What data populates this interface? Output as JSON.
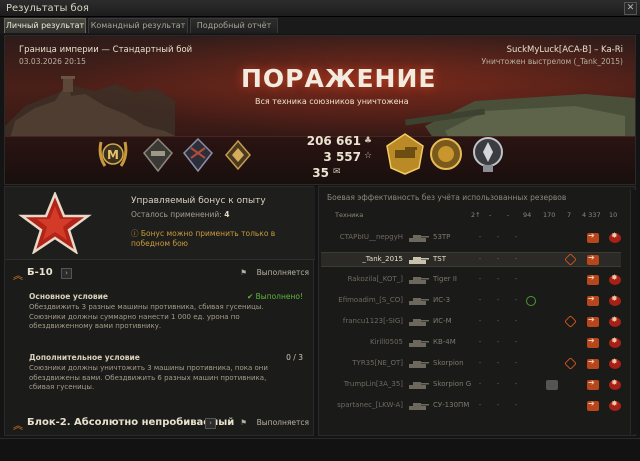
{
  "window": {
    "title": "Результаты боя"
  },
  "tabs": [
    {
      "label": "Личный результат",
      "active": true
    },
    {
      "label": "Командный результат",
      "active": false
    },
    {
      "label": "Подробный отчёт",
      "active": false
    }
  ],
  "header": {
    "map": "Граница империи — Стандартный бой",
    "date": "03.03.2026 20:15",
    "player": "SuckMyLuck[ACA-B] – Ka-Ri",
    "killed_by": "Уничтожен выстрелом (_Tank_2015)",
    "result": "ПОРАЖЕНИЕ",
    "result_sub": "Вся техника союзников уничтожена"
  },
  "stats": {
    "credits": "206 661",
    "xp": "3 557",
    "free_xp": "35"
  },
  "bonus": {
    "title": "Управляемый бонус к опыту",
    "remaining_label": "Осталось применений:",
    "remaining_value": "4",
    "warning": "Бонус можно применить только в победном бою"
  },
  "missions": [
    {
      "name": "Б-10",
      "status": "Выполняется",
      "main_title": "Основное условие",
      "main_done": "✔ Выполнено!",
      "main_text": "Обездвижить 3 разные машины противника, сбивая гусеницы. Союзники должны суммарно нанести 1 000 ед. урона по обездвиженному вами противнику.",
      "extra_title": "Дополнительное условие",
      "extra_count": "0 / 3",
      "extra_text": "Союзники должны уничтожить 3 машины противника, пока они обездвижены вами. Обездвижить 6 разных машин противника, сбивая гусеницы."
    },
    {
      "name": "Блок-2. Абсолютно непробиваемый",
      "status": "Выполняется"
    }
  ],
  "efficiency": {
    "title": "Боевая эффективность без учёта использованных резервов",
    "column_tech": "Техника",
    "columns": [
      "2↑",
      "-",
      "-",
      "94",
      "170",
      "7",
      "4 337",
      "10"
    ]
  },
  "rows": [
    {
      "player": "CTAPbIU__nepgyH",
      "tank": "53TP",
      "selected": false,
      "icons": [
        "arrow",
        "blast"
      ]
    },
    {
      "player": "_Tank_2015",
      "tank": "TST",
      "selected": true,
      "icons": [
        "track",
        "arrow"
      ]
    },
    {
      "player": "Rakozila[_KOT_]",
      "tank": "Tiger II",
      "selected": false,
      "icons": [
        "arrow",
        "blast"
      ]
    },
    {
      "player": "Efimoadim_[S_CO]",
      "tank": "ИС-3",
      "selected": false,
      "icons": [
        "spot",
        "arrow",
        "blast"
      ]
    },
    {
      "player": "francu1123[-SIG]",
      "tank": "ИС-М",
      "selected": false,
      "icons": [
        "track",
        "arrow",
        "blast"
      ]
    },
    {
      "player": "Kirill0505",
      "tank": "КВ-4М",
      "selected": false,
      "icons": [
        "arrow",
        "blast"
      ]
    },
    {
      "player": "TYR35[NE_OT]",
      "tank": "Skorpion",
      "selected": false,
      "icons": [
        "track",
        "arrow",
        "blast"
      ]
    },
    {
      "player": "TrumpLin[3A_35]",
      "tank": "Skorpion G",
      "selected": false,
      "icons": [
        "assist",
        "arrow",
        "blast"
      ]
    },
    {
      "player": "spartanec_[LKW-A]",
      "tank": "СУ-130ПМ",
      "selected": false,
      "icons": [
        "arrow",
        "blast"
      ]
    }
  ]
}
